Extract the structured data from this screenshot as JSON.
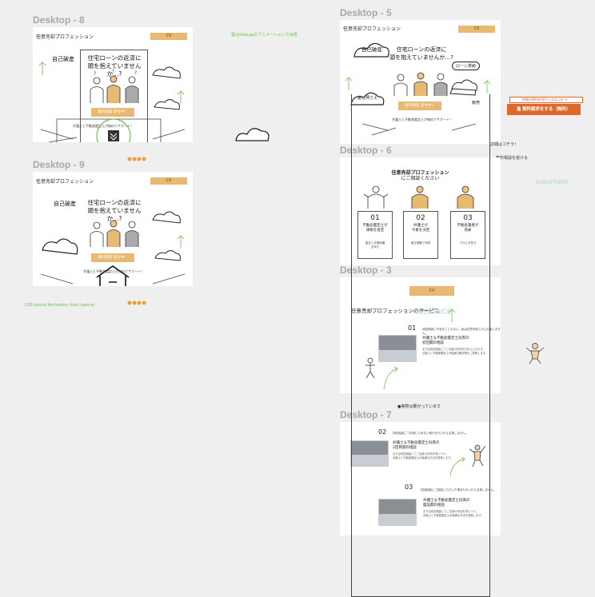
{
  "colors": {
    "canvas": "#efefef",
    "accent_gold": "#e8b973",
    "green": "#6abf4b",
    "orange": "#e0662a",
    "solution": "#b9dde0"
  },
  "frames": {
    "d8": {
      "label": "Desktop - 8",
      "header_title": "任意売却プロフェッション",
      "cv": "CV",
      "bankrupt": "自己破産",
      "headline": "住宅ローンの返済に\n頭を抱えていませんか...?",
      "button": "無料相談 受付中！",
      "sub": "弁護士と不動産鑑定士が無料でサポート！"
    },
    "d9": {
      "label": "Desktop - 9",
      "header_title": "任意売却プロフェッション",
      "cv": "CV",
      "bankrupt": "自己破産",
      "headline": "住宅ローンの返済に\n頭を抱えていませんか...?",
      "button": "無料相談 受付中！",
      "sub": "弁護士と不動産鑑定士が無料でサポート！"
    },
    "d5": {
      "label": "Desktop - 5",
      "header_title": "任意売却プロフェッション",
      "cv": "CV",
      "bankrupt": "自己破産",
      "headline": "住宅ローンの返済に\n頭を抱えていませんか...?",
      "loan": "ローン滞納",
      "sashiosae": "差し押さえ",
      "button": "無料相談 受付中！",
      "sub": "弁護士と不動産鑑定士が無料でサポート！",
      "baikyaku": "競売"
    },
    "d6": {
      "label": "Desktop - 6",
      "title": "任意売却プロフェッション",
      "subtitle": "にご相談ください",
      "cards": [
        {
          "num": "01",
          "title": "不動産鑑定士が\n価格を査定",
          "desc": "査定と法律知識\n交渉力"
        },
        {
          "num": "02",
          "title": "弁護士が\n今後を決定",
          "desc": "適正価格で売却"
        },
        {
          "num": "03",
          "title": "不動産業者が\n売却",
          "desc": "プロにお任せ"
        }
      ]
    },
    "d3": {
      "label": "Desktop - 3",
      "cv": "CV",
      "title_pre": "任意売却プロフェッションの",
      "title_bold": "サービス",
      "title_en": "SERVICE",
      "num": "01",
      "line": "初回相談に不安なこともない。私は任意売却し行える事しません。",
      "heading": "弁護士＆不動産鑑定士同席の\n初回無料相談",
      "body": "まずは初回相談にてご自身の状況をお伝えいただき、\n弁護士と不動産鑑定士が最適な解決策をご提案します。"
    },
    "d7": {
      "label": "Desktop - 7",
      "num2": "02",
      "line2": "初回相談にて利用にためない執行を行い行える事しません。",
      "heading2": "弁護士＆不動産鑑定士同席の\n2回目無料相談",
      "body2": "まずは初回相談にてご自身の状況を伺いつつ、\n弁護士と不動産鑑定士が最適な方法を提案します。",
      "num3": "03",
      "line3": "初回相談にご相談いただいた場合も行い行える事しません。",
      "heading3": "弁護士＆不動産鑑定士同席の\n面談無料相談",
      "body3": "まずは初回相談にてご自身の状況を伺いつつ、\n弁護士と不動産鑑定士が最適な方法を提案します。"
    }
  },
  "notes": {
    "slideup": "雲はslideupのアニメーションで出現",
    "css_bound": "CSS bound Animation (text type-a)",
    "between": "●実際は繋がっています",
    "detail": "詳細はコチラ！",
    "free_consult": "無料相談を受ける",
    "solution": "SOLUTION",
    "cta_top": "特典の資料を見たい方はコチラ！",
    "cta_main": "資料請求をする（無料）"
  }
}
